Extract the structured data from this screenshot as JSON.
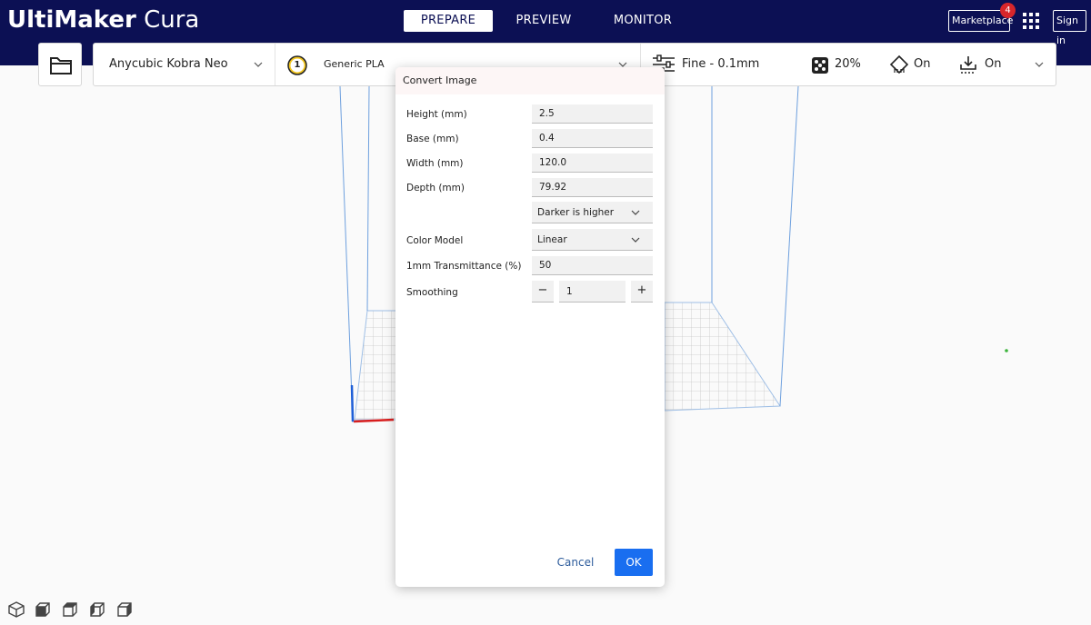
{
  "header": {
    "logo_bold": "UltiMaker",
    "logo_light": " Cura",
    "tabs": [
      "PREPARE",
      "PREVIEW",
      "MONITOR"
    ],
    "marketplace_label": "Marketplace",
    "marketplace_badge": "4",
    "signin_label": "Sign in"
  },
  "toolbar": {
    "printer": "Anycubic Kobra Neo",
    "extruder_number": "1",
    "material": "Generic PLA",
    "profile": "Fine - 0.1mm",
    "infill": "20%",
    "support": "On",
    "adhesion": "On"
  },
  "dialog": {
    "title": "Convert Image",
    "height_label": "Height (mm)",
    "height_value": "2.5",
    "base_label": "Base (mm)",
    "base_value": "0.4",
    "width_label": "Width (mm)",
    "width_value": "120.0",
    "depth_label": "Depth (mm)",
    "depth_value": "79.92",
    "lightness_value": "Darker is higher",
    "color_model_label": "Color Model",
    "color_model_value": "Linear",
    "transmittance_label": "1mm Transmittance (%)",
    "transmittance_value": "50",
    "smoothing_label": "Smoothing",
    "smoothing_value": "1",
    "minus": "−",
    "plus": "+",
    "cancel_label": "Cancel",
    "ok_label": "OK"
  },
  "colors": {
    "header_bg": "#0c1054",
    "accent_blue": "#196ef0",
    "badge_red": "#d7262b"
  }
}
